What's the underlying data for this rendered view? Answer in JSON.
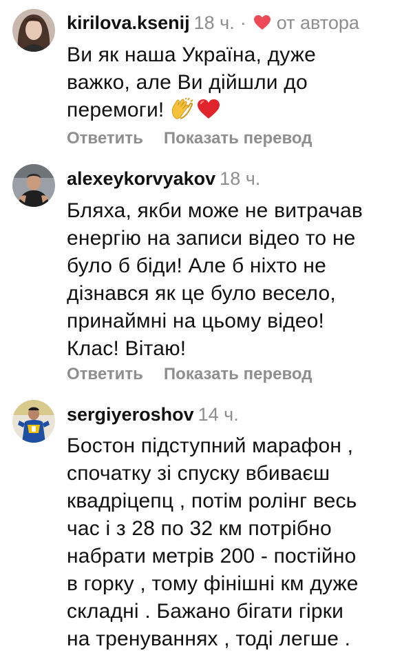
{
  "colors": {
    "text": "#111111",
    "muted": "#8e8e8e",
    "heart": "#ed4956"
  },
  "comments": [
    {
      "username": "kirilova.ksenij",
      "time": "18 ч.",
      "separator": "·",
      "liked_by_author": "от автора",
      "liked_icon": "heart-icon",
      "text": "Ви як наша Україна, дуже\nважко, але Ви дійшли до\nперемоги!",
      "emojis": [
        "clapping-hands-emoji",
        "red-heart-emoji"
      ],
      "reply": "Ответить",
      "translate": "Показать перевод"
    },
    {
      "username": "alexeykorvyakov",
      "time": "18 ч.",
      "text": "Бляха, якби може не витрачав\nенергію на записи відео то не\nбуло б біди! Але б ніхто не\nдізнався як це було весело,\nпринаймні на цьому відео!\nКлас! Вітаю!",
      "reply": "Ответить",
      "translate": "Показать перевод"
    },
    {
      "username": "sergiyeroshov",
      "time": "14 ч.",
      "text": "Бостон підступний марафон ,\nспочатку зі спуску вбиваєш\nквадріцепц , потім ролінг весь\nчас  і з 28 по 32 км потрібно\nнабрати метрів 200 - постійно\nв горку , тому фінішні км дуже\nскладні . Бажано бігати гірки\nна тренуваннях , тоді легше ."
    }
  ]
}
